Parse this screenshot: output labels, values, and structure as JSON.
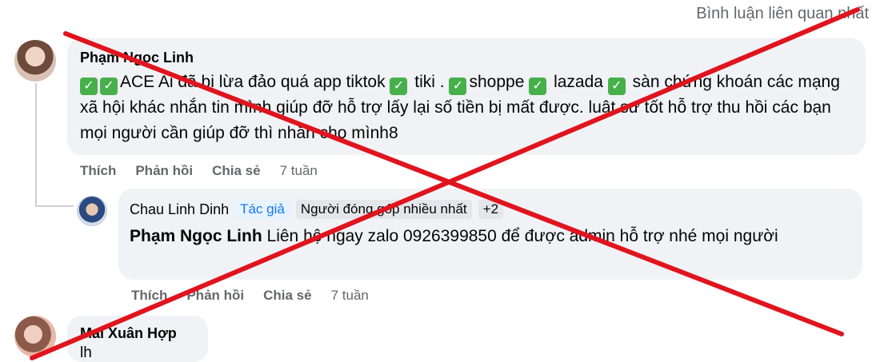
{
  "sort": {
    "label": "Bình luận liên quan nhất"
  },
  "comments": [
    {
      "author": "Phạm Ngọc Linh",
      "text": {
        "check_icon": "check-mark-icon",
        "p1": "ACE Ai đã bị lừa đảo quá app tiktok",
        "p2": "tiki .",
        "p3": "shoppe",
        "p4": "lazada",
        "p5": "sàn chứng khoán các mạng xã hội khác nhắn tin mình giúp đỡ hỗ trợ lấy lại số tiền bị mất được. luật sư tốt hỗ trợ thu hồi các bạn mọi người cần giúp đỡ thì nhắn cho mình8"
      },
      "actions": {
        "like": "Thích",
        "reply": "Phản hồi",
        "share": "Chia sẻ",
        "time": "7 tuần"
      }
    },
    {
      "author": "Chau Linh Dinh",
      "badges": {
        "role": "Tác giả",
        "contributor": "Người đóng góp nhiều nhất",
        "more": "+2"
      },
      "mention": "Phạm Ngọc Linh",
      "text": "Liên hệ ngay zalo 0926399850 để được admin hỗ trợ nhé mọi người",
      "actions": {
        "like": "Thích",
        "reply": "Phản hồi",
        "share": "Chia sẻ",
        "time": "7 tuần"
      }
    },
    {
      "author": "Mai Xuân Hợp",
      "text": "lh"
    }
  ],
  "overlay": {
    "type": "red-x-cross",
    "color": "#e0141e"
  },
  "colors": {
    "bubble": "#f0f2f5",
    "secondary_text": "#65676b",
    "accent": "#1877f2",
    "check": "#47b04b"
  }
}
